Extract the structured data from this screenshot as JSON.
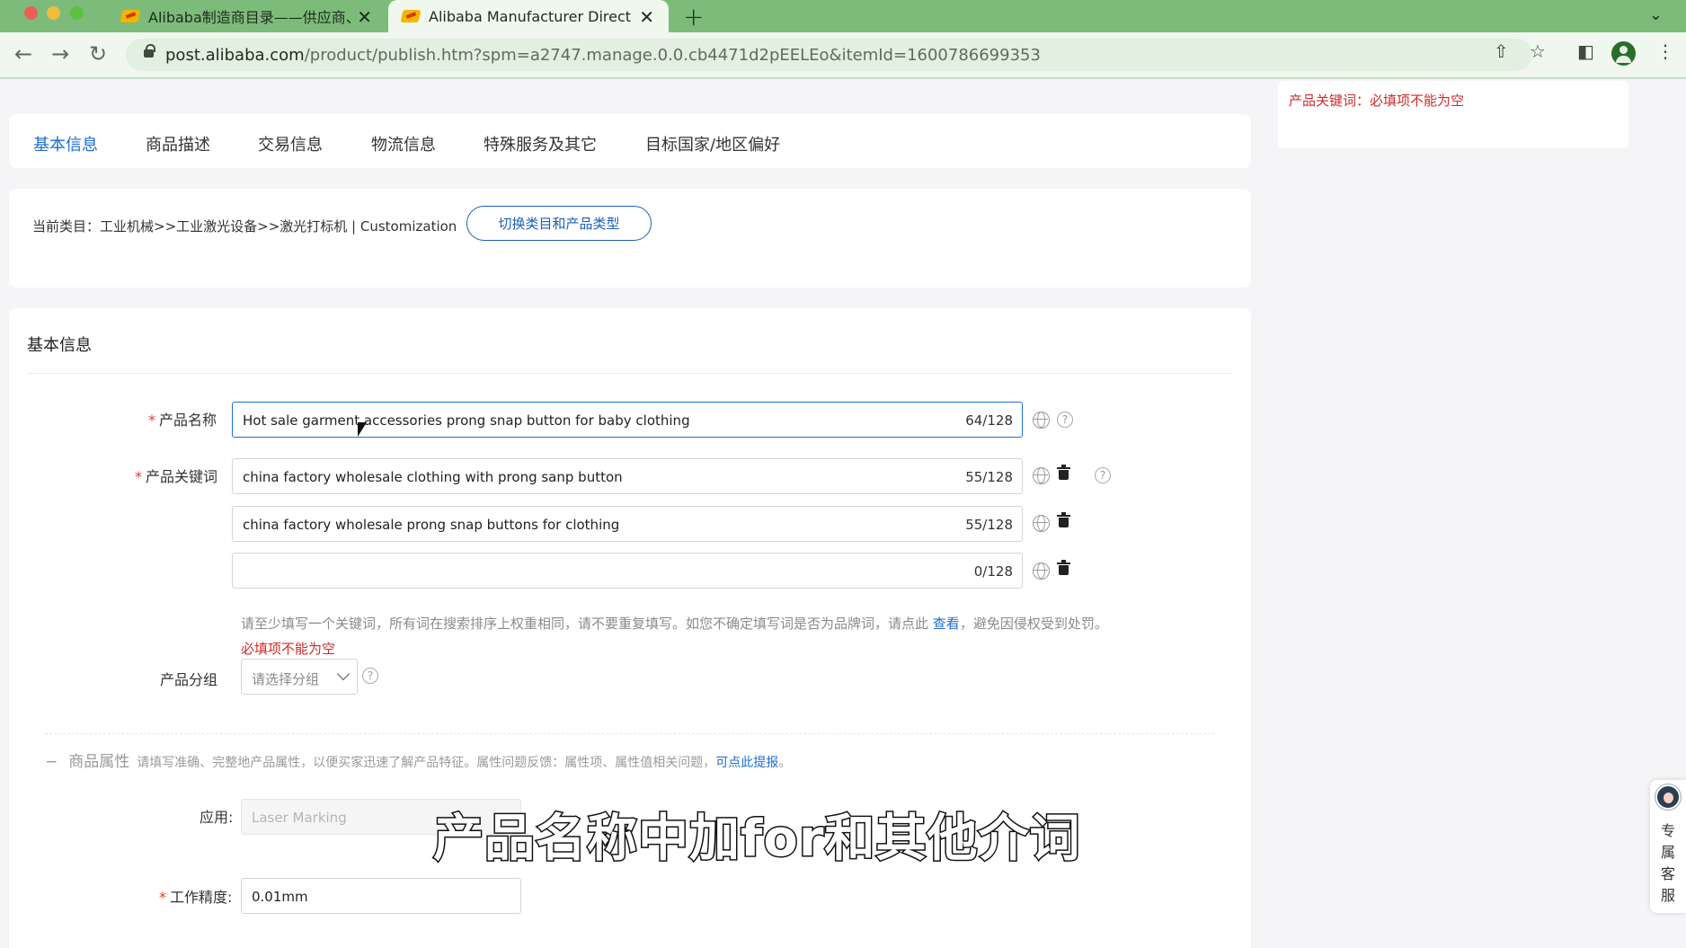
{
  "browser": {
    "tabs": [
      {
        "title": "Alibaba制造商目录——供应商、"
      },
      {
        "title": "Alibaba Manufacturer Directory"
      }
    ],
    "url_host": "post.alibaba.com",
    "url_path": "/product/publish.htm?spm=a2747.manage.0.0.cb4471d2pEELEo&itemId=1600786699353"
  },
  "top_error": {
    "text": "产品关键词：必填项不能为空"
  },
  "nav_tabs": [
    "基本信息",
    "商品描述",
    "交易信息",
    "物流信息",
    "特殊服务及其它",
    "目标国家/地区偏好"
  ],
  "category": {
    "text": "当前类目：工业机械>>工业激光设备>>激光打标机 | Customization",
    "switch_label": "切换类目和产品类型"
  },
  "basic": {
    "title": "基本信息",
    "product_name_label": "产品名称",
    "product_name_value": "Hot sale garment accessories prong snap button for baby clothing",
    "product_name_count": "64/128",
    "keywords_label": "产品关键词",
    "keywords": [
      {
        "value": "china factory wholesale clothing with prong sanp button",
        "count": "55/128"
      },
      {
        "value": "china factory wholesale prong snap buttons for clothing",
        "count": "55/128"
      },
      {
        "value": "",
        "count": "0/128"
      }
    ],
    "keyword_hint": "请至少填写一个关键词，所有词在搜索排序上权重相同，请不要重复填写。如您不确定填写词是否为品牌词，请点此",
    "keyword_hint_link": "查看",
    "keyword_hint_tail": "，避免因侵权受到处罚。",
    "required_error": "必填项不能为空",
    "group_label": "产品分组",
    "group_placeholder": "请选择分组",
    "help_glyph": "?"
  },
  "attributes": {
    "minus": "−",
    "title": "商品属性",
    "desc": "请填写准确、完整地产品属性，以便买家迅速了解产品特征。属性问题反馈：属性项、属性值相关问题，",
    "link": "可点此提报",
    "link_tail": "。",
    "application_label": "应用:",
    "application_value": "Laser Marking",
    "precision_label": "工作精度:",
    "precision_value": "0.01mm"
  },
  "subtitle": "产品名称中加for和其他介词",
  "customer_service": "专属客服"
}
